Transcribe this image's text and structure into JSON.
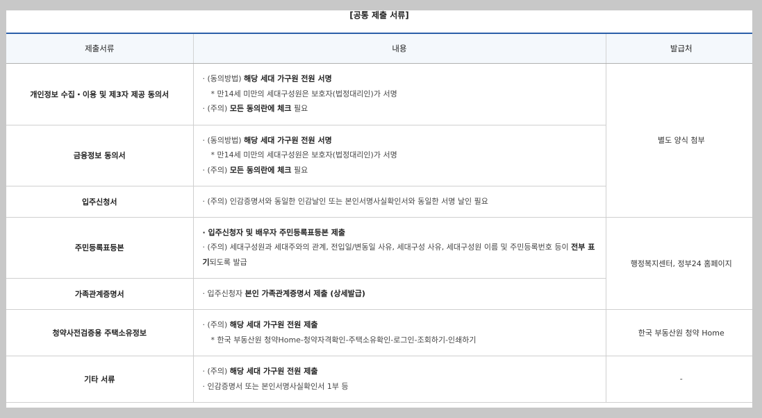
{
  "title": "[공통 제출 서류]",
  "headers": {
    "doc": "제출서류",
    "content": "내용",
    "issuer": "발급처"
  },
  "rows": [
    {
      "doc": "개인정보 수집・이용 및 제3자 제공 동의서",
      "lines": [
        {
          "a": "· (동의방법) ",
          "b": "해당 세대 가구원 전원 서명",
          "c": ""
        },
        {
          "a": "* 만14세 미만의 세대구성원은 보호자(법정대리인)가 서명",
          "b": "",
          "c": ""
        },
        {
          "a": "· (주의) ",
          "b": "모든 동의란에 체크",
          "c": " 필요"
        }
      ]
    },
    {
      "doc": "금융정보 동의서",
      "lines": [
        {
          "a": "· (동의방법) ",
          "b": "해당 세대 가구원 전원 서명",
          "c": ""
        },
        {
          "a": "* 만14세 미만의 세대구성원은 보호자(법정대리인)가 서명",
          "b": "",
          "c": ""
        },
        {
          "a": "· (주의) ",
          "b": "모든 동의란에 체크",
          "c": " 필요"
        }
      ]
    },
    {
      "doc": "입주신청서",
      "lines": [
        {
          "a": "· (주의) 인감증명서와 동일한 인감날인 또는 본인서명사실확인서와 동일한 서명 날인 필요",
          "b": "",
          "c": ""
        }
      ]
    },
    {
      "doc": "주민등록표등본",
      "lines": [
        {
          "a": "",
          "b": "· 입주신청자 및 배우자 주민등록표등본 제출",
          "c": ""
        },
        {
          "a": "· (주의) 세대구성원과 세대주와의 관계, 전입일/변동일 사유, 세대구성 사유, 세대구성원 이름 및 주민등록번호 등이 ",
          "b": "전부 표기",
          "c": "되도록 발급"
        }
      ]
    },
    {
      "doc": "가족관계증명서",
      "lines": [
        {
          "a": "· 입주신청자 ",
          "b": "본인 가족관계증명서 제출 (상세발급)",
          "c": ""
        }
      ]
    },
    {
      "doc": "청약사전검증용 주택소유정보",
      "lines": [
        {
          "a": "· (주의) ",
          "b": "해당 세대 가구원 전원 제출",
          "c": ""
        },
        {
          "a": "* 한국 부동산원 청약Home-청약자격확인-주택소유확인-로그인-조회하기-인쇄하기",
          "b": "",
          "c": ""
        }
      ]
    },
    {
      "doc": "기타 서류",
      "lines": [
        {
          "a": "· (주의) ",
          "b": "해당 세대 가구원 전원 제출",
          "c": ""
        },
        {
          "a": "· 인감증명서 또는 본인서명사실확인서 1부 등",
          "b": "",
          "c": ""
        }
      ]
    }
  ],
  "issuers": [
    "별도 양식 첨부",
    "행정복지센터, 정부24 홈페이지",
    "한국 부동산원 청약 Home",
    "-"
  ]
}
